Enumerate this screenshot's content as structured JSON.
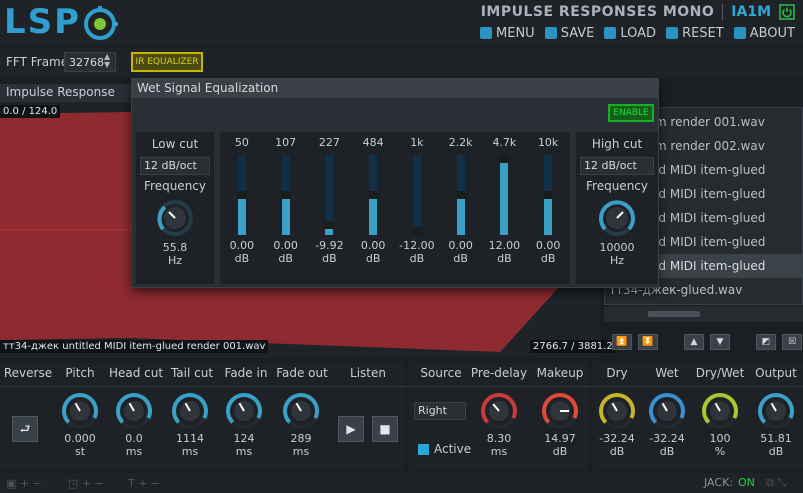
{
  "header": {
    "logo_text": "LSP",
    "plugin_title": "IMPULSE RESPONSES MONO",
    "plugin_id": "IA1M",
    "menu": [
      {
        "label": "MENU",
        "icon": "menu-icon"
      },
      {
        "label": "SAVE",
        "icon": "save-icon"
      },
      {
        "label": "LOAD",
        "icon": "load-icon"
      },
      {
        "label": "RESET",
        "icon": "reset-icon"
      },
      {
        "label": "ABOUT",
        "icon": "about-icon"
      }
    ]
  },
  "toolbar": {
    "fft_label": "FFT Frame",
    "fft_value": "32768",
    "ir_eq_label": "IR EQUALIZER"
  },
  "impulse": {
    "header": "Impulse Response",
    "coord": "0.0 / 124.0",
    "file": "тт34-джек untitled MIDI item-glued render 001.wav",
    "length": "2766.7 / 3881.2"
  },
  "file_list": [
    "MIDI item render 001.wav",
    "MIDI item render 002.wav",
    "k untitled MIDI item-glued",
    "k untitled MIDI item-glued",
    "k untitled MIDI item-glued",
    "k untitled MIDI item-glued",
    "k untitled MIDI item-glued",
    "тт34-джек-glued.wav"
  ],
  "file_list_selected_index": 6,
  "list_nav": [
    "⏫",
    "⏬",
    "▲",
    "▼",
    "◩",
    "☒"
  ],
  "eq": {
    "title": "Wet Signal Equalization",
    "enable_label": "ENABLE",
    "low_cut": {
      "label": "Low cut",
      "slope": "12 dB/oct",
      "freq_label": "Frequency",
      "value": "55.8",
      "unit": "Hz"
    },
    "high_cut": {
      "label": "High cut",
      "slope": "12 dB/oct",
      "freq_label": "Frequency",
      "value": "10000",
      "unit": "Hz"
    },
    "bands": [
      {
        "freq": "50",
        "gain": "0.00",
        "unit": "dB",
        "level": 0.5
      },
      {
        "freq": "107",
        "gain": "0.00",
        "unit": "dB",
        "level": 0.5
      },
      {
        "freq": "227",
        "gain": "-9.92",
        "unit": "dB",
        "level": 0.09
      },
      {
        "freq": "484",
        "gain": "0.00",
        "unit": "dB",
        "level": 0.5
      },
      {
        "freq": "1k",
        "gain": "-12.00",
        "unit": "dB",
        "level": 0.0
      },
      {
        "freq": "2.2k",
        "gain": "0.00",
        "unit": "dB",
        "level": 0.5
      },
      {
        "freq": "4.7k",
        "gain": "12.00",
        "unit": "dB",
        "level": 1.0
      },
      {
        "freq": "10k",
        "gain": "0.00",
        "unit": "dB",
        "level": 0.5
      }
    ]
  },
  "controls": {
    "labels": [
      "Reverse",
      "Pitch",
      "Head cut",
      "Tail cut",
      "Fade in",
      "Fade out",
      "Listen"
    ],
    "knobs": [
      {
        "value": "0.000",
        "unit": "st"
      },
      {
        "value": "0.0",
        "unit": "ms"
      },
      {
        "value": "1114",
        "unit": "ms"
      },
      {
        "value": "124",
        "unit": "ms"
      },
      {
        "value": "289",
        "unit": "ms"
      }
    ]
  },
  "source": {
    "labels": [
      "Source",
      "Pre-delay",
      "Makeup"
    ],
    "source_value": "Right",
    "active_label": "Active",
    "predelay": {
      "value": "8.30",
      "unit": "ms"
    },
    "makeup": {
      "value": "14.97",
      "unit": "dB"
    }
  },
  "mix": {
    "labels": [
      "Dry",
      "Wet",
      "Dry/Wet",
      "Output"
    ],
    "knobs": [
      {
        "value": "-32.24",
        "unit": "dB",
        "color": "#c4b42a"
      },
      {
        "value": "-32.24",
        "unit": "dB",
        "color": "#3a8fd0"
      },
      {
        "value": "100",
        "unit": "%",
        "color": "#a7c92d"
      },
      {
        "value": "51.81",
        "unit": "dB",
        "color": "#3aa0c6"
      }
    ]
  },
  "statusbar": {
    "jack_label": "JACK:",
    "jack_state": "ON"
  },
  "colors": {
    "accent": "#2ea8d6",
    "ir_fill": "#9b2c32",
    "eq_yellow": "#c5b800",
    "enable_green": "#17b025"
  }
}
